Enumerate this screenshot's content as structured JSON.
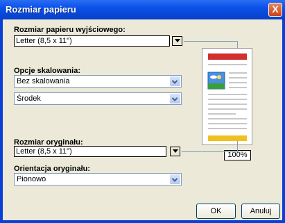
{
  "window": {
    "title": "Rozmiar papieru",
    "close_label": "X"
  },
  "output_size": {
    "label": "Rozmiar papieru wyjściowego:",
    "value": "Letter (8,5 x 11\")"
  },
  "scaling": {
    "label": "Opcje skalowania:",
    "mode_value": "Bez skalowania",
    "position_value": "Środek"
  },
  "original_size": {
    "label": "Rozmiar oryginału:",
    "value": "Letter (8,5 x 11\")"
  },
  "orientation": {
    "label": "Orientacja oryginału:",
    "value": "Pionowo"
  },
  "preview": {
    "zoom": "100%"
  },
  "buttons": {
    "ok": "OK",
    "cancel": "Anuluj"
  },
  "colors": {
    "title_bar": "#0a51e8",
    "dialog_bg": "#ece9d8",
    "preview_header": "#d0312d",
    "preview_footer": "#f0c020"
  }
}
